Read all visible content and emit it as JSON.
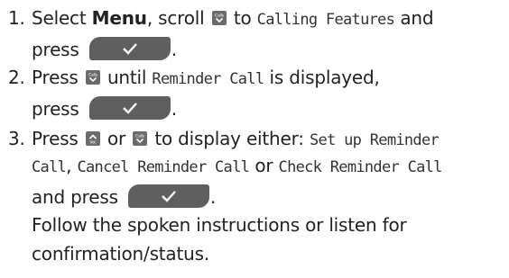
{
  "steps": [
    {
      "number": "1.",
      "line1": {
        "t1": "Select ",
        "bold": "Menu",
        "t2": ", scroll ",
        "t3": " to ",
        "lcd": "Calling Features",
        "t4": " and"
      },
      "line2": {
        "t1": "press ",
        "t2": "."
      }
    },
    {
      "number": "2.",
      "line1": {
        "t1": "Press ",
        "t2": " until ",
        "lcd": "Reminder Call",
        "t3": " is displayed,"
      },
      "line2": {
        "t1": "press ",
        "t2": "."
      }
    },
    {
      "number": "3.",
      "line1": {
        "t1": "Press ",
        "t2": " or ",
        "t3": " to display either: ",
        "lcd": "Set up Reminder"
      },
      "line2": {
        "lcd1": "Call",
        "t1": ", ",
        "lcd2": "Cancel Reminder Call",
        "t2": " or ",
        "lcd3": "Check Reminder Call"
      },
      "line3": {
        "t1": "and press ",
        "t2": "."
      },
      "line4": "Follow the spoken instructions or listen for",
      "line5": "confirmation/status."
    }
  ],
  "icons": {
    "down_key": {
      "name": "calls-down-key-icon",
      "label": "Calls"
    },
    "up_key": {
      "name": "vol-up-key-icon",
      "label": "Vol."
    },
    "ok_key": {
      "name": "ok-checkmark-key-icon"
    }
  },
  "colors": {
    "text": "#222222",
    "key": "#6b6b6b",
    "ok_key": "#5f5f5f"
  }
}
